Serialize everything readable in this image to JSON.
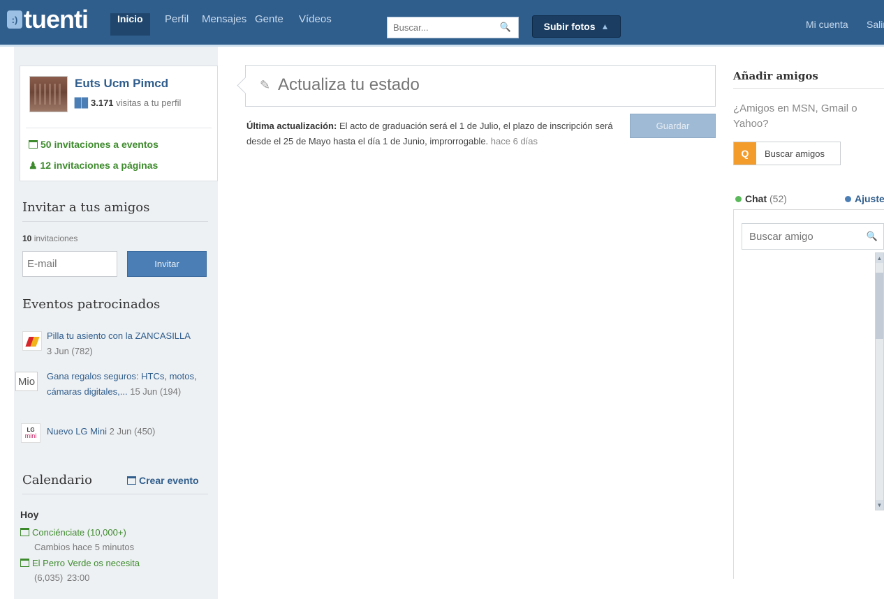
{
  "header": {
    "logo_badge": ":)",
    "logo_text": "tuenti",
    "nav": [
      "Inicio",
      "Perfil",
      "Mensajes",
      "Gente",
      "Vídeos"
    ],
    "search_placeholder": "Buscar...",
    "upload_label": "Subir fotos",
    "account_label": "Mi cuenta",
    "logout_label": "Salir"
  },
  "profile": {
    "name": "Euts Ucm Pimcd",
    "visits_count": "3.171",
    "visits_text": "visitas a tu perfil",
    "event_invitations": "50 invitaciones a eventos",
    "page_invitations": "12 invitaciones a páginas"
  },
  "invite": {
    "title": "Invitar a tus amigos",
    "count": "10",
    "count_text": "invitaciones",
    "email_placeholder": "E-mail",
    "button_label": "Invitar"
  },
  "sponsored": {
    "title": "Eventos patrocinados",
    "items": [
      {
        "icon": "iberia-logo",
        "title": "Pilla tu asiento con la ZANCASILLA",
        "meta": "3 Jun (782)"
      },
      {
        "icon": "mio-logo",
        "icon_text": "Mio",
        "title": "Gana regalos seguros: HTCs, motos, cámaras digitales,...",
        "meta": "15 Jun (194)"
      },
      {
        "icon": "lg-logo",
        "icon_text_1": "LG",
        "icon_text_2": "mini",
        "title": "Nuevo LG Mini",
        "meta": "2 Jun (450)"
      }
    ]
  },
  "calendar": {
    "title": "Calendario",
    "create_label": "Crear evento",
    "today_label": "Hoy",
    "items": [
      {
        "title": "Conciénciate (10,000+)",
        "meta": "Cambios hace 5 minutos"
      },
      {
        "title": "El Perro Verde os necesita",
        "meta_count": "(6,035)",
        "meta_time": "23:00"
      }
    ]
  },
  "status": {
    "placeholder": "Actualiza tu estado",
    "last_update_label": "Última actualización:",
    "last_update_text": "El acto de graduación será el 1 de Julio, el plazo de inscripción será desde el 25 de Mayo hasta el día 1 de Junio, improrrogable.",
    "last_update_time": "hace 6 días",
    "save_label": "Guardar"
  },
  "friends": {
    "title": "Añadir amigos",
    "question": "¿Amigos en MSN, Gmail o Yahoo?",
    "find_label": "Buscar amigos",
    "chat_label": "Chat",
    "chat_count": "(52)",
    "settings_label": "Ajustes",
    "search_placeholder": "Buscar amigo"
  },
  "colors": {
    "topbar": "#2f5d8c",
    "accent_green": "#3d8a2c",
    "link_blue": "#2f5d8c",
    "find_orange": "#f39c2b"
  }
}
